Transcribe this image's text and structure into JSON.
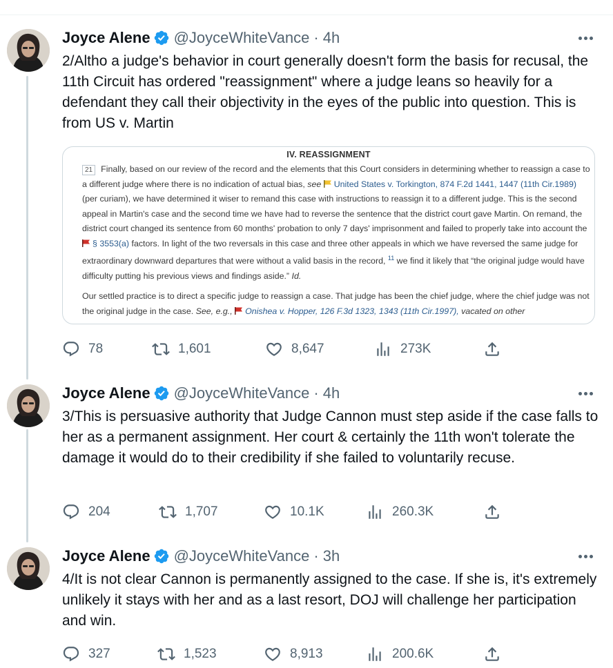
{
  "tweets": [
    {
      "author": {
        "name": "Joyce Alene",
        "handle": "@JoyceWhiteVance"
      },
      "time": "4h",
      "text": "2/Altho a judge's behavior in court generally doesn't form the basis for recusal, the 11th Circuit has ordered \"reassignment\" where a judge leans so heavily for a defendant they call their objectivity in the eyes of the public into question. This is from US v. Martin",
      "image": {
        "heading": "IV. REASSIGNMENT",
        "para_number": "21",
        "p1_a": "Finally, based on our review of the record and the elements that this Court considers in determining whether to reassign a case to a different judge where there is no indication of actual bias,",
        "p1_see": "see",
        "p1_cite1": "United States v. Torkington, 874 F.2d 1441, 1447 (11th Cir.1989)",
        "p1_b": "(per curiam), we have determined it wiser to remand this case with instructions to reassign it to a different judge. This is the second appeal in Martin's case and the second time we have had to reverse the sentence that the district court gave Martin. On remand, the district court changed its sentence from 60 months' probation to only 7 days' imprisonment and failed to properly take into account the",
        "p1_cite2": "§ 3553(a)",
        "p1_c": "factors. In light of the two reversals in this case and three other appeals in which we have reversed the same judge for extraordinary downward departures that were without a valid basis in the record,",
        "p1_footnote": "11",
        "p1_d": "we find it likely that “the original judge would have difficulty putting his previous views and findings aside.”",
        "p1_id": "Id.",
        "p2_a": "Our settled practice is to direct a specific judge to reassign a case. That judge has been the chief judge, where the chief judge was not the original judge in the case.",
        "p2_see": "See, e.g.,",
        "p2_cite": "Onishea v. Hopper, 126 F.3d 1323, 1343 (11th Cir.1997),",
        "p2_b": "vacated on other"
      },
      "stats": {
        "replies": "78",
        "retweets": "1,601",
        "likes": "8,647",
        "views": "273K"
      }
    },
    {
      "author": {
        "name": "Joyce Alene",
        "handle": "@JoyceWhiteVance"
      },
      "time": "4h",
      "text": "3/This is persuasive authority that Judge Cannon must step aside if the case falls to her as a permanent assignment. Her court & certainly the 11th won't tolerate the damage it would do to their credibility if she failed to voluntarily recuse.",
      "stats": {
        "replies": "204",
        "retweets": "1,707",
        "likes": "10.1K",
        "views": "260.3K"
      }
    },
    {
      "author": {
        "name": "Joyce Alene",
        "handle": "@JoyceWhiteVance"
      },
      "time": "3h",
      "text": "4/It is not clear Cannon is permanently assigned to the case. If she is, it's extremely unlikely it stays with her and as a last resort, DOJ will challenge her participation and win.",
      "stats": {
        "replies": "327",
        "retweets": "1,523",
        "likes": "8,913",
        "views": "200.6K"
      }
    }
  ],
  "separator": "·",
  "colors": {
    "text": "#0f1419",
    "secondary": "#536471",
    "verified": "#1d9bf0",
    "link": "#2c5d8f",
    "flag_yellow": "#f2c230",
    "flag_red": "#d0322b"
  },
  "icons": [
    "verified-badge-icon",
    "more-icon",
    "reply-icon",
    "retweet-icon",
    "like-icon",
    "views-icon",
    "share-icon"
  ]
}
